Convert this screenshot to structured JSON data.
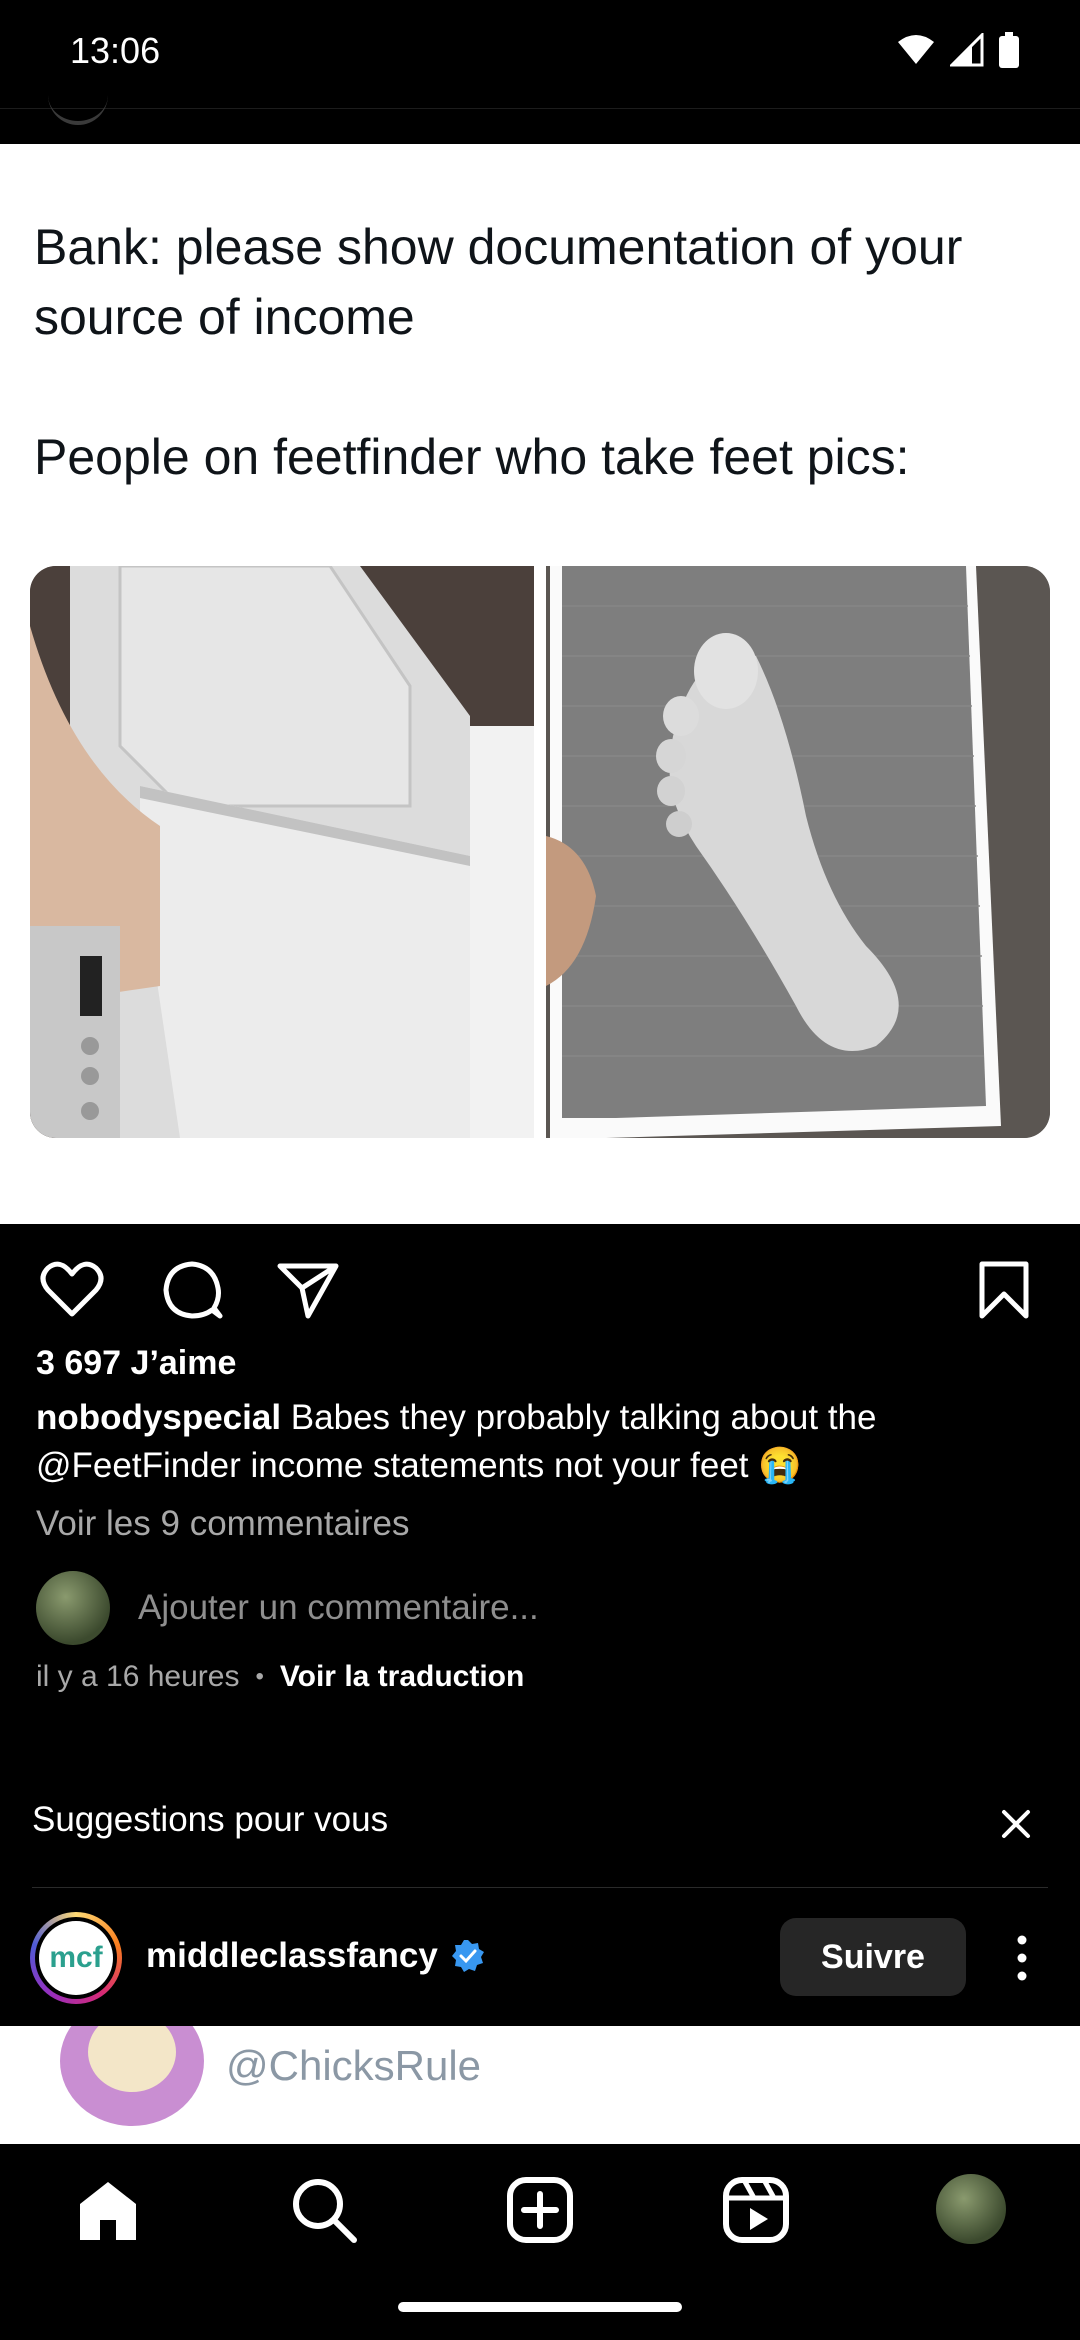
{
  "status_bar": {
    "time": "13:06"
  },
  "post": {
    "tweet_text": "Bank: please show documentation of your source of income\n\nPeople on feetfinder who take feet pics:",
    "likes": "3 697 J’aime",
    "caption_user": "nobodyspecial",
    "caption_text": "Babes they probably talking about the @FeetFinder income statements not your feet 😭",
    "view_comments": "Voir les 9 commentaires",
    "add_comment_placeholder": "Ajouter un commentaire...",
    "time_ago": "il y a 16 heures",
    "meta_separator": "•",
    "translate": "Voir la traduction"
  },
  "suggestions": {
    "title": "Suggestions pour vous",
    "account": {
      "username": "middleclassfancy",
      "logo_text": "mcf",
      "follow_label": "Suivre"
    }
  },
  "next_post": {
    "handle": "@ChicksRule"
  },
  "icons": {
    "like": "heart-icon",
    "comment": "comment-icon",
    "share": "send-icon",
    "save": "bookmark-icon",
    "close": "close-icon",
    "more": "more-vertical-icon",
    "verified": "verified-badge-icon",
    "nav": [
      "home-icon",
      "search-icon",
      "create-icon",
      "reels-icon",
      "profile-avatar"
    ]
  },
  "colors": {
    "verified": "#3897f0",
    "follow_button": "#262626",
    "secondary_text": "#a8a8a8"
  }
}
